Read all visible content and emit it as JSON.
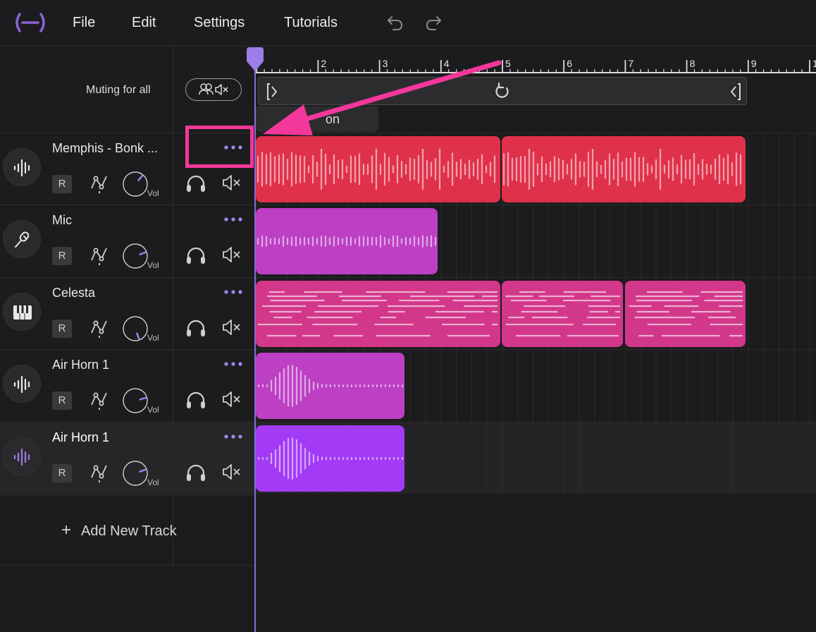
{
  "menu": {
    "items": [
      "File",
      "Edit",
      "Settings",
      "Tutorials"
    ]
  },
  "header": {
    "muting_label": "Muting for all"
  },
  "ruler": {
    "bar_numbers": [
      "2",
      "3",
      "4",
      "5",
      "6",
      "7",
      "8",
      "9",
      "1"
    ]
  },
  "section": {
    "label": "on"
  },
  "tracks": [
    {
      "name": "Memphis - Bonk ...",
      "icon": "waveform-icon",
      "r_label": "R",
      "vol_label": "Vol",
      "color": "#e0314a",
      "selected": false
    },
    {
      "name": "Mic",
      "icon": "microphone-icon",
      "r_label": "R",
      "vol_label": "Vol",
      "color": "#bc3fc4",
      "selected": false
    },
    {
      "name": "Celesta",
      "icon": "piano-keys-icon",
      "r_label": "R",
      "vol_label": "Vol",
      "color": "#d2378a",
      "selected": false
    },
    {
      "name": "Air Horn 1",
      "icon": "waveform-icon",
      "r_label": "R",
      "vol_label": "Vol",
      "color": "#bc3fc4",
      "selected": false
    },
    {
      "name": "Air Horn 1",
      "icon": "waveform-icon",
      "r_label": "R",
      "vol_label": "Vol",
      "color": "#a33af5",
      "selected": true
    }
  ],
  "add_track": {
    "label": "Add New Track"
  },
  "colors": {
    "accent": "#8a6bd8",
    "callout": "#f4379a"
  }
}
